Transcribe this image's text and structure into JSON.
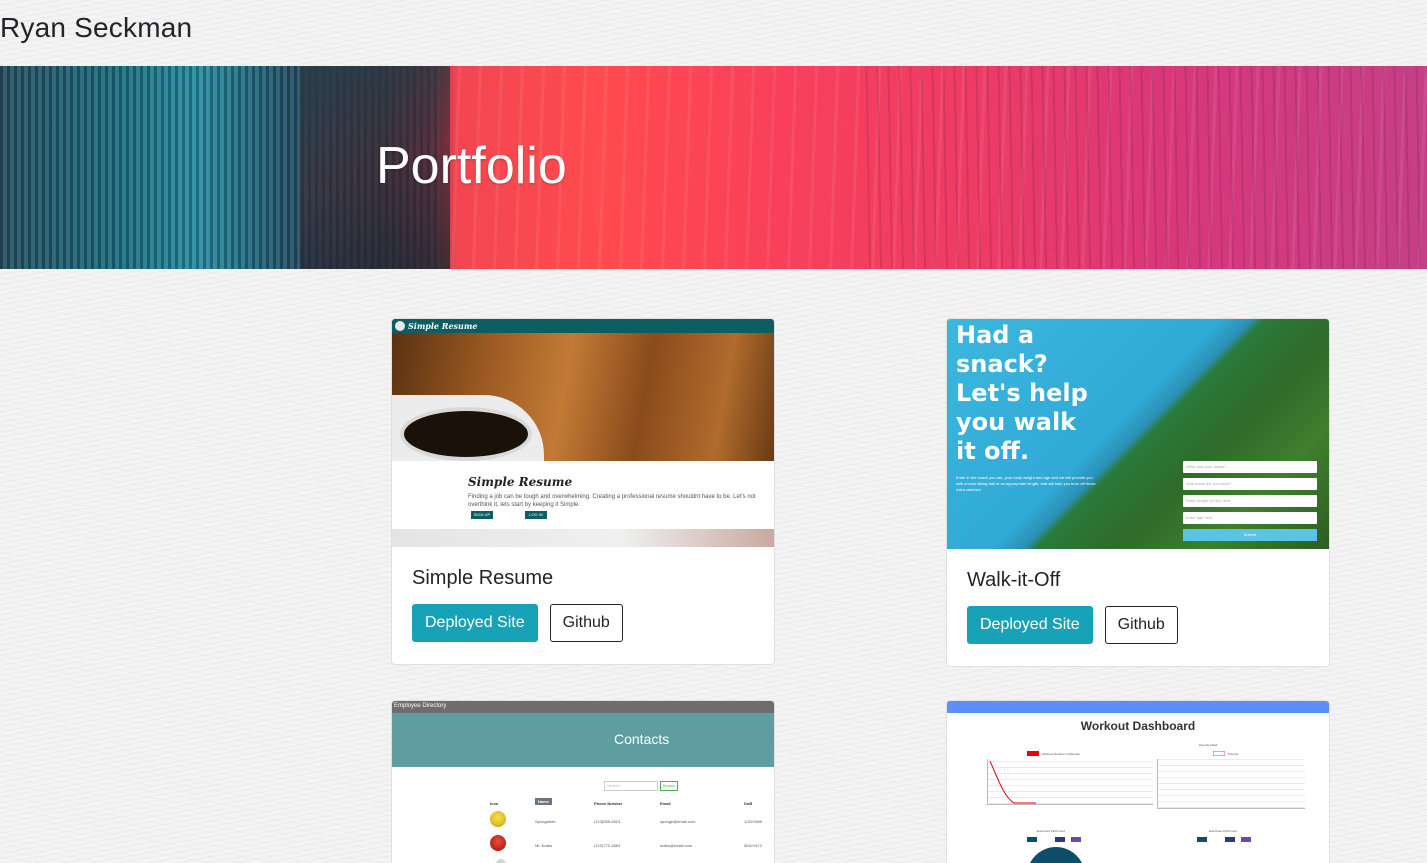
{
  "header": {
    "brand": "Ryan Seckman"
  },
  "hero": {
    "title": "Portfolio"
  },
  "projects": [
    {
      "title": "Simple Resume",
      "deployed_label": "Deployed Site",
      "github_label": "Github",
      "thumb": {
        "nav_title": "Simple Resume",
        "heading": "Simple Resume",
        "text": "Finding a job can be tough and overwhelming. Creating a professional resume shouldnt have to be. Let's not overthink it, lets start by keeping it Simple.",
        "btn1": "SIGN UP",
        "btn2": "LOG IN"
      }
    },
    {
      "title": "Walk-it-Off",
      "deployed_label": "Deployed Site",
      "github_label": "Github",
      "thumb": {
        "headline": "Had a snack? Let's help you walk it off.",
        "submit": "Submit"
      }
    },
    {
      "title": "Employee Directory",
      "thumb": {
        "nav_title": "Employee Directory",
        "heading": "Contacts",
        "search_placeholder": "Search",
        "search_button": "Search",
        "columns": [
          "Icon",
          "Name",
          "Phone Number",
          "Email",
          "DoB"
        ],
        "rows": [
          [
            "Spongebob",
            "(123)555-4523",
            "sponge@email.com",
            "1/20/1985"
          ],
          [
            "Mr. Krabs",
            "(123)772-4563",
            "krabs@email.com",
            "5/04/1973"
          ]
        ]
      }
    },
    {
      "title": "Workout Dashboard",
      "thumb": {
        "heading": "Workout Dashboard",
        "chart1_legend": "Workout Duration in Minutes",
        "chart2_title": "Pounds Lifted",
        "chart2_legend": "Pounds",
        "chart3_title": "Exercises Performed",
        "chart4_title": "Exercises Performed"
      }
    }
  ],
  "colors": {
    "primary_button": "#17a2b8",
    "text": "#212529"
  }
}
